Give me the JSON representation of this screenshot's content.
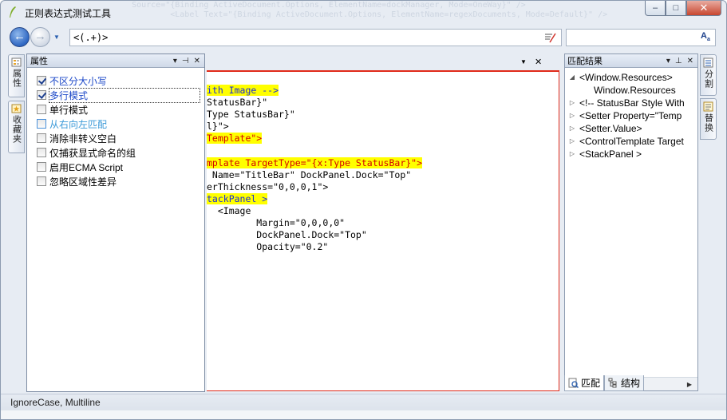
{
  "window": {
    "title": "正则表达式测试工具",
    "background_code": "    Source=\"{Binding ActiveDocument.Options, ElementName=dockManager, Mode=OneWay}\" />\n            <Label Text=\"{Binding ActiveDocument.Options, ElementName=regexDocuments, Mode=Default}\" />",
    "controls": {
      "minimize": "–",
      "maximize": "□",
      "close": "✕"
    }
  },
  "toolbar": {
    "back_icon": "back-arrow-icon",
    "forward_icon": "forward-arrow-icon",
    "regex_value": "<(.+)>",
    "replace_value": "",
    "back_glyph": "←",
    "forward_glyph": "→",
    "font_glyph": "A"
  },
  "left_tabs": [
    {
      "label": "属性",
      "icon": "properties-icon"
    },
    {
      "label": "收藏夹",
      "icon": "favorites-icon"
    }
  ],
  "properties": {
    "title": "属性",
    "header_tools": [
      "▾",
      "⊣",
      "✕"
    ],
    "options": [
      {
        "label": "不区分大小写",
        "checked": true
      },
      {
        "label": "多行模式",
        "checked": true
      },
      {
        "label": "单行模式",
        "checked": false
      },
      {
        "label": "从右向左匹配",
        "checked": false
      },
      {
        "label": "消除非转义空白",
        "checked": false
      },
      {
        "label": "仅捕获显式命名的组",
        "checked": false
      },
      {
        "label": "启用ECMA Script",
        "checked": false
      },
      {
        "label": "忽略区域性差异",
        "checked": false
      }
    ]
  },
  "editor": {
    "close_glyph": "✕",
    "drop_glyph": "▼",
    "lines": [
      {
        "parts": [
          [
            "hlb",
            "ith Image -->"
          ]
        ]
      },
      {
        "parts": [
          [
            "",
            "StatusBar}\""
          ]
        ]
      },
      {
        "parts": [
          [
            "",
            "Type StatusBar}\""
          ]
        ]
      },
      {
        "parts": [
          [
            "",
            "l}\">"
          ]
        ]
      },
      {
        "parts": [
          [
            "hl",
            "Template\">"
          ]
        ]
      },
      {
        "parts": [
          [
            "",
            ""
          ]
        ]
      },
      {
        "parts": [
          [
            "hl",
            "mplate TargetType=\"{x:Type StatusBar}\">"
          ]
        ]
      },
      {
        "parts": [
          [
            "",
            " Name=\"TitleBar\" DockPanel.Dock=\"Top\""
          ]
        ]
      },
      {
        "parts": [
          [
            "",
            "erThickness=\"0,0,0,1\">"
          ]
        ]
      },
      {
        "parts": [
          [
            "hlb",
            "tackPanel >"
          ]
        ]
      },
      {
        "parts": [
          [
            "",
            "  <Image"
          ]
        ]
      },
      {
        "parts": [
          [
            "",
            "         Margin=\"0,0,0,0\""
          ]
        ]
      },
      {
        "parts": [
          [
            "",
            "         DockPanel.Dock=\"Top\""
          ]
        ]
      },
      {
        "parts": [
          [
            "",
            "         Opacity=\"0.2\""
          ]
        ]
      }
    ]
  },
  "results": {
    "title": "匹配结果",
    "header_tools": [
      "▾",
      "⊥",
      "✕"
    ],
    "nodes": [
      {
        "text": "<Window.Resources>",
        "expanded": true,
        "indent": 0
      },
      {
        "text": "Window.Resources",
        "expanded": null,
        "indent": 1
      },
      {
        "text": "<!-- StatusBar Style With",
        "expanded": false,
        "indent": 0
      },
      {
        "text": "<Setter Property=\"Temp",
        "expanded": false,
        "indent": 0
      },
      {
        "text": "<Setter.Value>",
        "expanded": false,
        "indent": 0
      },
      {
        "text": "<ControlTemplate Target",
        "expanded": false,
        "indent": 0
      },
      {
        "text": "<StackPanel >",
        "expanded": false,
        "indent": 0
      }
    ],
    "tabs": [
      {
        "label": "匹配",
        "icon": "match-icon",
        "active": true
      },
      {
        "label": "结构",
        "icon": "tree-icon",
        "active": false
      }
    ],
    "scroll_left": "◀",
    "scroll_right": "▶",
    "thumb_grip": "|||"
  },
  "right_tabs": [
    {
      "label": "分割",
      "icon": "split-icon"
    },
    {
      "label": "替换",
      "icon": "replace-icon"
    }
  ],
  "status": {
    "text": "IgnoreCase, Multiline"
  }
}
